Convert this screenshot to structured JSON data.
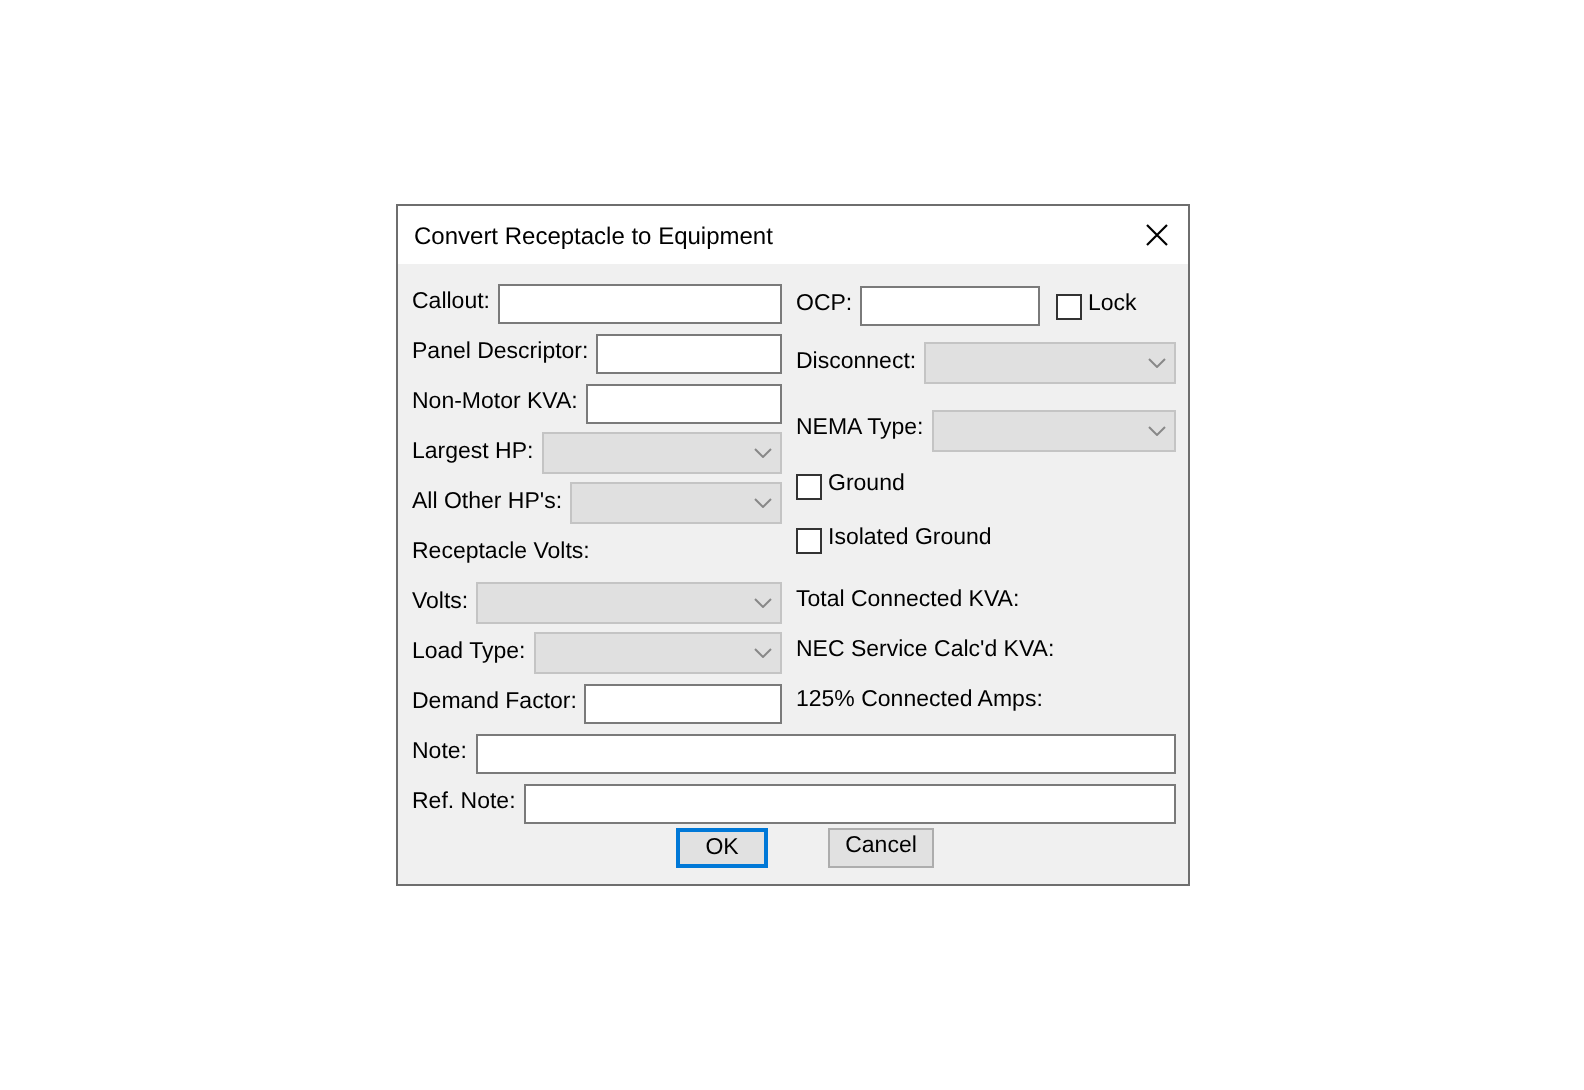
{
  "window": {
    "title": "Convert Receptacle to Equipment"
  },
  "left": [
    {
      "kind": "text",
      "label": "Callout:"
    },
    {
      "kind": "text",
      "label": "Panel Descriptor:"
    },
    {
      "kind": "text",
      "label": "Non-Motor KVA:"
    },
    {
      "kind": "combo",
      "label": "Largest HP:",
      "disabled": true
    },
    {
      "kind": "combo",
      "label": "All Other HP's:",
      "disabled": true
    },
    {
      "kind": "heading",
      "label": "Receptacle Volts:"
    },
    {
      "kind": "combo",
      "label": "Volts:",
      "disabled": true
    },
    {
      "kind": "combo",
      "label": "Load Type:",
      "disabled": true
    },
    {
      "kind": "text",
      "label": "Demand Factor:"
    }
  ],
  "right": [
    {
      "kind": "text_lock",
      "label": "OCP:",
      "checkbox": {
        "label": "Lock",
        "checked": false
      }
    },
    {
      "kind": "combo",
      "label": "Disconnect:",
      "disabled": true
    },
    {
      "kind": "combo",
      "label": "NEMA Type:",
      "disabled": true
    },
    {
      "kind": "checkbox",
      "label": "Ground",
      "checked": false
    },
    {
      "kind": "checkbox",
      "label": "Isolated Ground",
      "checked": false
    },
    {
      "kind": "heading",
      "label": "Total Connected KVA:"
    },
    {
      "kind": "heading",
      "label": "NEC Service Calc'd KVA:"
    },
    {
      "kind": "heading",
      "label": "125% Connected Amps:"
    }
  ],
  "bottom": [
    {
      "kind": "text",
      "label": "Note:"
    },
    {
      "kind": "text",
      "label": "Ref. Note:"
    }
  ],
  "buttons": [
    {
      "label": "OK",
      "default": true
    },
    {
      "label": "Cancel",
      "default": false
    }
  ]
}
